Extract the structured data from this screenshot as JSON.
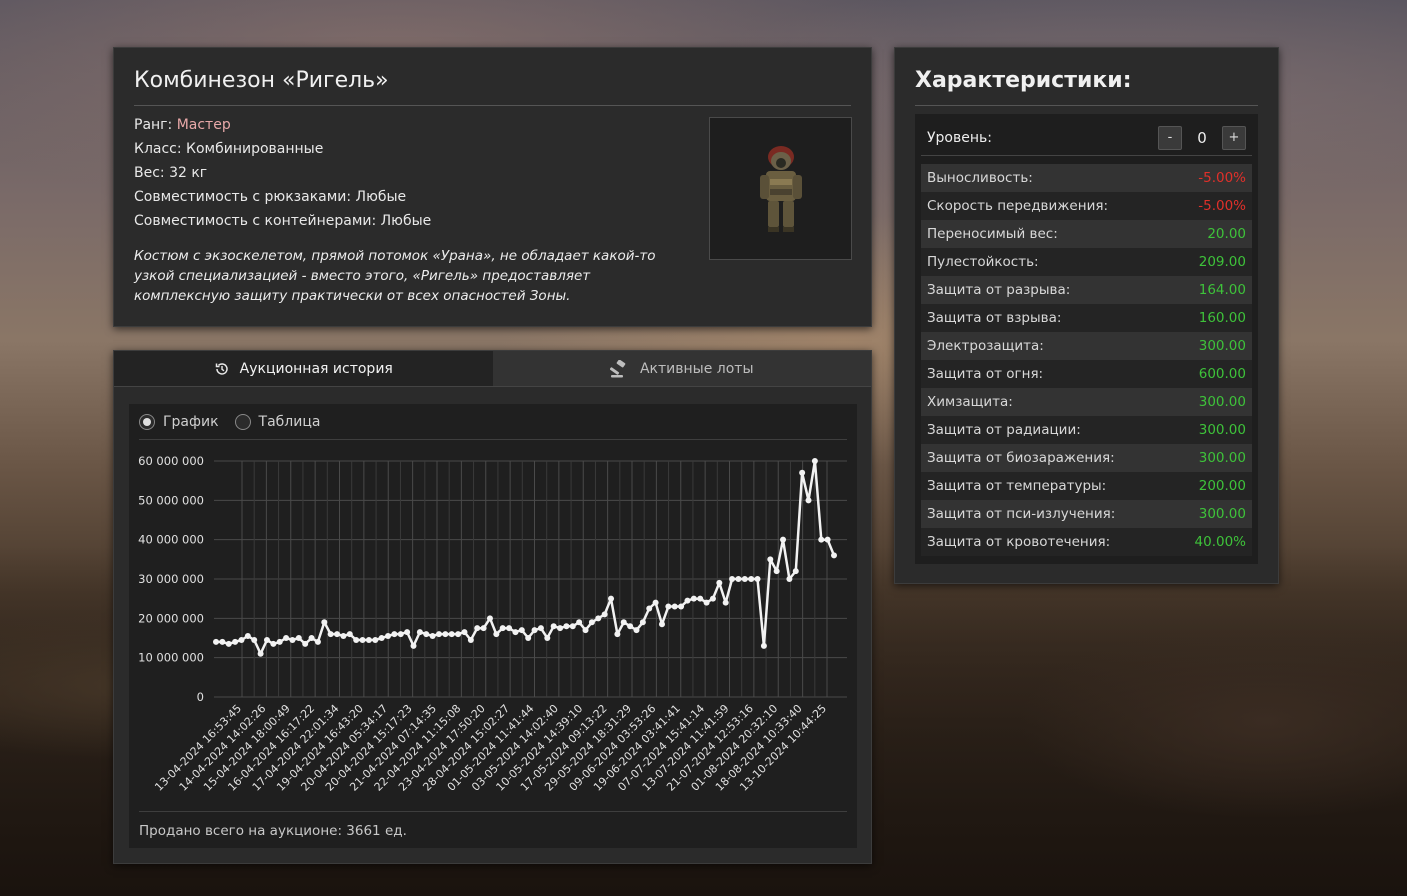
{
  "item": {
    "title": "Комбинезон «Ригель»",
    "rank_label": "Ранг:",
    "rank_value": "Мастер",
    "class_line": "Класс: Комбинированные",
    "weight_line": "Вес: 32 кг",
    "backpack_line": "Совместимость с рюкзаками: Любые",
    "container_line": "Совместимость с контейнерами: Любые",
    "description": "Костюм с экзоскелетом, прямой потомок «Урана», не обладает какой-то узкой специализацией - вместо этого, «Ригель» предоставляет комплексную защиту практически от всех опасностей Зоны.",
    "image_icon": "exosuit-icon"
  },
  "stats": {
    "title": "Характеристики:",
    "level_label": "Уровень:",
    "level_value": "0",
    "minus_label": "-",
    "plus_label": "+",
    "rows": [
      {
        "label": "Выносливость:",
        "value": "-5.00%",
        "sign": "neg"
      },
      {
        "label": "Скорость передвижения:",
        "value": "-5.00%",
        "sign": "neg"
      },
      {
        "label": "Переносимый вес:",
        "value": "20.00",
        "sign": "pos"
      },
      {
        "label": "Пулестойкость:",
        "value": "209.00",
        "sign": "pos"
      },
      {
        "label": "Защита от разрыва:",
        "value": "164.00",
        "sign": "pos"
      },
      {
        "label": "Защита от взрыва:",
        "value": "160.00",
        "sign": "pos"
      },
      {
        "label": "Электрозащита:",
        "value": "300.00",
        "sign": "pos"
      },
      {
        "label": "Защита от огня:",
        "value": "600.00",
        "sign": "pos"
      },
      {
        "label": "Химзащита:",
        "value": "300.00",
        "sign": "pos"
      },
      {
        "label": "Защита от радиации:",
        "value": "300.00",
        "sign": "pos"
      },
      {
        "label": "Защита от биозаражения:",
        "value": "300.00",
        "sign": "pos"
      },
      {
        "label": "Защита от температуры:",
        "value": "200.00",
        "sign": "pos"
      },
      {
        "label": "Защита от пси-излучения:",
        "value": "300.00",
        "sign": "pos"
      },
      {
        "label": "Защита от кровотечения:",
        "value": "40.00%",
        "sign": "pos"
      }
    ]
  },
  "auction": {
    "tab_history": "Аукционная история",
    "tab_history_icon": "history-icon",
    "tab_lots": "Активные лоты",
    "tab_lots_icon": "gavel-icon",
    "radio_chart": "График",
    "radio_table": "Таблица",
    "selected_view": "chart",
    "sold_total": "Продано всего на аукционе: 3661 ед."
  },
  "colors": {
    "negative": "#e0302a",
    "positive": "#3ec23a",
    "rank": "#e8a8a8",
    "line": "#f2f2f2"
  },
  "chart_data": {
    "type": "line",
    "title": "",
    "xlabel": "",
    "ylabel": "",
    "ylim": [
      0,
      60000000
    ],
    "yticks": [
      0,
      10000000,
      20000000,
      30000000,
      40000000,
      50000000,
      60000000
    ],
    "ytick_labels": [
      "0",
      "10 000 000",
      "20 000 000",
      "30 000 000",
      "40 000 000",
      "50 000 000",
      "60 000 000"
    ],
    "xtick_labels": [
      "13-04-2024 16:53:45",
      "14-04-2024 14:02:26",
      "15-04-2024 18:00:49",
      "16-04-2024 16:17:22",
      "17-04-2024 22:01:34",
      "19-04-2024 16:43:20",
      "20-04-2024 05:34:17",
      "20-04-2024 15:17:23",
      "21-04-2024 07:14:35",
      "22-04-2024 11:15:08",
      "23-04-2024 17:50:20",
      "28-04-2024 15:02:27",
      "01-05-2024 11:41:44",
      "03-05-2024 14:02:40",
      "10-05-2024 14:39:10",
      "17-05-2024 09:13:22",
      "29-05-2024 18:31:29",
      "09-06-2024 03:53:26",
      "19-06-2024 03:41:41",
      "07-07-2024 15:41:14",
      "13-07-2024 11:41:59",
      "21-07-2024 12:53:16",
      "01-08-2024 20:32:10",
      "18-08-2024 10:33:40",
      "13-10-2024 10:44:25"
    ],
    "grid": true,
    "series": [
      {
        "values": [
          14000000,
          14000000,
          13500000,
          14000000,
          14500000,
          15500000,
          14500000,
          11000000,
          14500000,
          13500000,
          14000000,
          15000000,
          14500000,
          15000000,
          13500000,
          15000000,
          14000000,
          19000000,
          16000000,
          16000000,
          15500000,
          16000000,
          14500000,
          14500000,
          14500000,
          14500000,
          15000000,
          15500000,
          16000000,
          16000000,
          16500000,
          13000000,
          16500000,
          16000000,
          15500000,
          16000000,
          16000000,
          16000000,
          16000000,
          16500000,
          14500000,
          17500000,
          17500000,
          20000000,
          16000000,
          17500000,
          17500000,
          16500000,
          17000000,
          15000000,
          17000000,
          17500000,
          15000000,
          18000000,
          17500000,
          18000000,
          18000000,
          19000000,
          17000000,
          19000000,
          20000000,
          21000000,
          25000000,
          16000000,
          19000000,
          18000000,
          17000000,
          19000000,
          22500000,
          24000000,
          18500000,
          23000000,
          23000000,
          23000000,
          24500000,
          25000000,
          25000000,
          24000000,
          25000000,
          29000000,
          24000000,
          30000000,
          30000000,
          30000000,
          30000000,
          30000000,
          13000000,
          35000000,
          32000000,
          40000000,
          30000000,
          32000000,
          57000000,
          50000000,
          60000000,
          40000000,
          40000000,
          36000000
        ]
      }
    ]
  }
}
